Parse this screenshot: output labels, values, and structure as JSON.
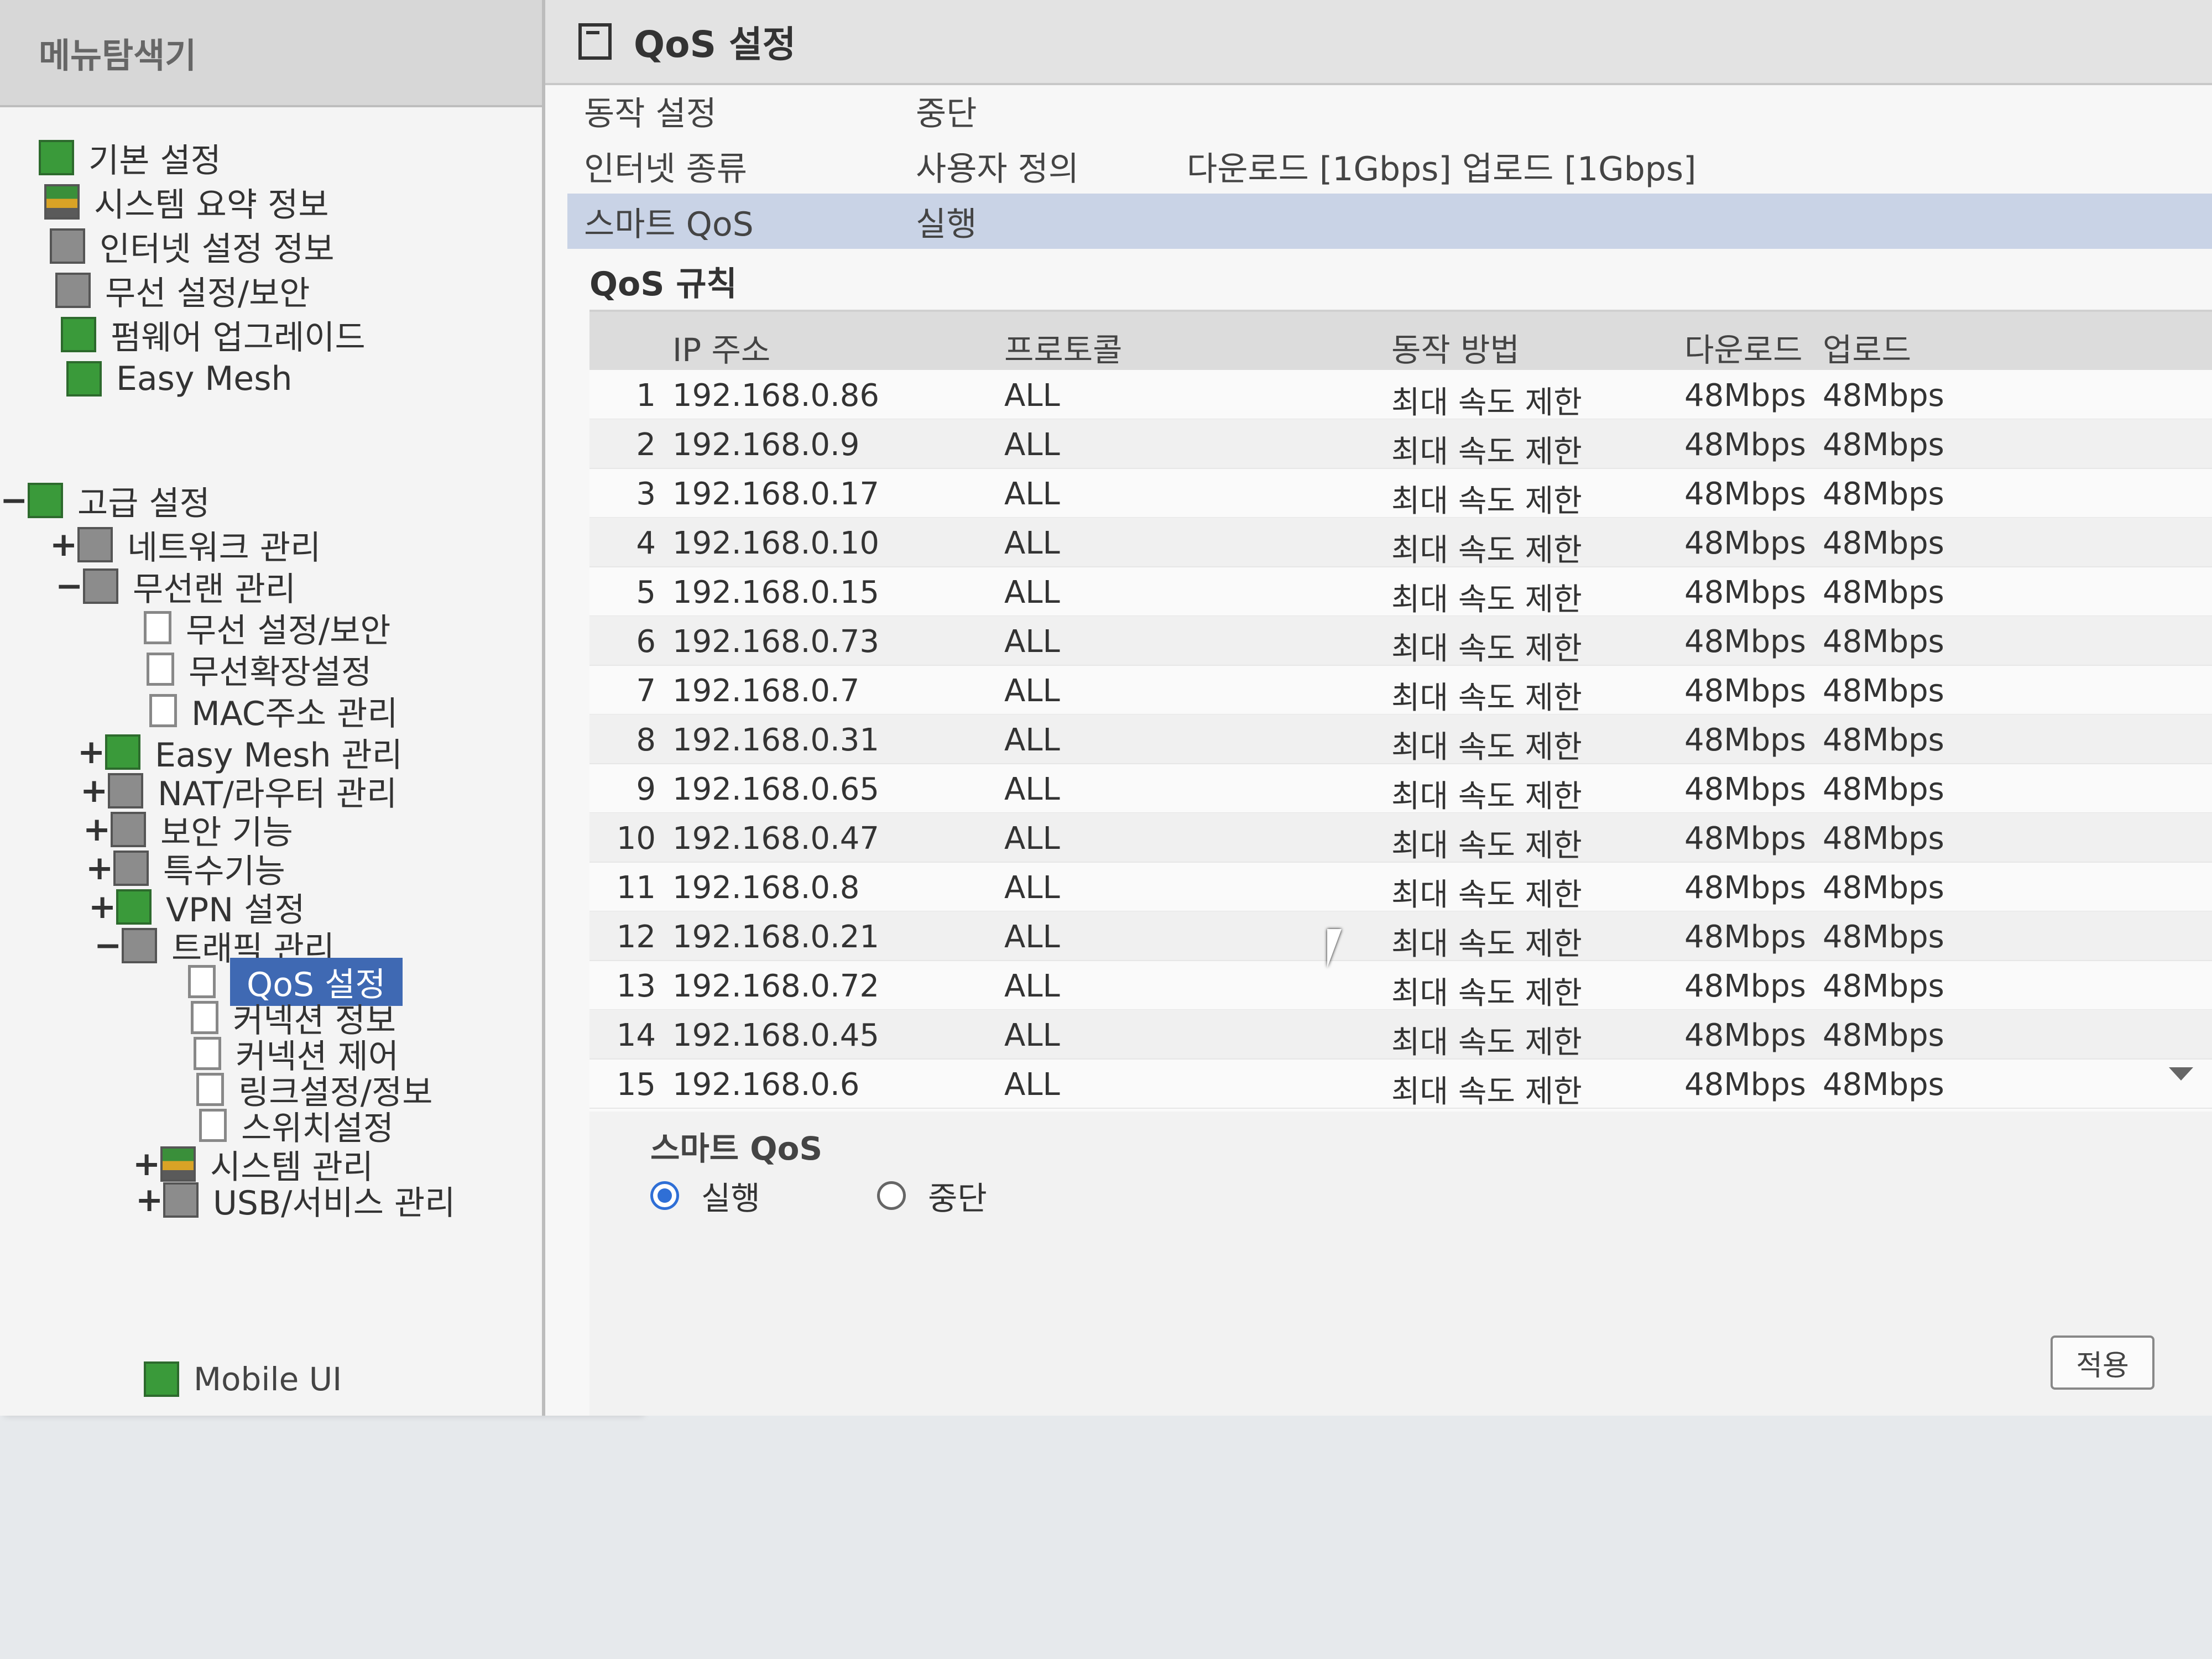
{
  "menu": {
    "header": "메뉴탐색기",
    "items": [
      {
        "label": "기본 설정",
        "expander": ""
      },
      {
        "label": "시스템 요약 정보",
        "expander": ""
      },
      {
        "label": "인터넷 설정 정보",
        "expander": ""
      },
      {
        "label": "무선 설정/보안",
        "expander": ""
      },
      {
        "label": "펌웨어 업그레이드",
        "expander": ""
      },
      {
        "label": "Easy Mesh",
        "expander": ""
      },
      {
        "label": "고급 설정",
        "expander": "−"
      },
      {
        "label": "네트워크 관리",
        "expander": "+"
      },
      {
        "label": "무선랜 관리",
        "expander": "−"
      },
      {
        "label": "무선 설정/보안",
        "expander": ""
      },
      {
        "label": "무선확장설정",
        "expander": ""
      },
      {
        "label": "MAC주소 관리",
        "expander": ""
      },
      {
        "label": "Easy Mesh 관리",
        "expander": "+"
      },
      {
        "label": "NAT/라우터 관리",
        "expander": "+"
      },
      {
        "label": "보안 기능",
        "expander": "+"
      },
      {
        "label": "특수기능",
        "expander": "+"
      },
      {
        "label": "VPN 설정",
        "expander": "+"
      },
      {
        "label": "트래픽 관리",
        "expander": "−"
      },
      {
        "label": "QoS 설정",
        "expander": ""
      },
      {
        "label": "커넥션 정보",
        "expander": ""
      },
      {
        "label": "커넥션 제어",
        "expander": ""
      },
      {
        "label": "링크설정/정보",
        "expander": ""
      },
      {
        "label": "스위치설정",
        "expander": ""
      },
      {
        "label": "시스템 관리",
        "expander": "+"
      },
      {
        "label": "USB/서비스 관리",
        "expander": "+"
      }
    ],
    "mobile_ui": "Mobile UI"
  },
  "page": {
    "title": "QoS 설정",
    "operation_label": "동작 설정",
    "operation_value": "중단",
    "internet_label": "인터넷 종류",
    "internet_value": "사용자 정의",
    "internet_speed": "다운로드 [1Gbps] 업로드 [1Gbps]",
    "smart_qos_label": "스마트 QoS",
    "smart_qos_value": "실행",
    "rules_title": "QoS 규칙"
  },
  "rules": {
    "headers": {
      "ip": "IP 주소",
      "protocol": "프로토콜",
      "action": "동작 방법",
      "download": "다운로드",
      "upload": "업로드"
    },
    "rows": [
      {
        "no": "1",
        "ip": "192.168.0.86",
        "protocol": "ALL",
        "action": "최대 속도 제한",
        "download": "48Mbps",
        "upload": "48Mbps"
      },
      {
        "no": "2",
        "ip": "192.168.0.9",
        "protocol": "ALL",
        "action": "최대 속도 제한",
        "download": "48Mbps",
        "upload": "48Mbps"
      },
      {
        "no": "3",
        "ip": "192.168.0.17",
        "protocol": "ALL",
        "action": "최대 속도 제한",
        "download": "48Mbps",
        "upload": "48Mbps"
      },
      {
        "no": "4",
        "ip": "192.168.0.10",
        "protocol": "ALL",
        "action": "최대 속도 제한",
        "download": "48Mbps",
        "upload": "48Mbps"
      },
      {
        "no": "5",
        "ip": "192.168.0.15",
        "protocol": "ALL",
        "action": "최대 속도 제한",
        "download": "48Mbps",
        "upload": "48Mbps"
      },
      {
        "no": "6",
        "ip": "192.168.0.73",
        "protocol": "ALL",
        "action": "최대 속도 제한",
        "download": "48Mbps",
        "upload": "48Mbps"
      },
      {
        "no": "7",
        "ip": "192.168.0.7",
        "protocol": "ALL",
        "action": "최대 속도 제한",
        "download": "48Mbps",
        "upload": "48Mbps"
      },
      {
        "no": "8",
        "ip": "192.168.0.31",
        "protocol": "ALL",
        "action": "최대 속도 제한",
        "download": "48Mbps",
        "upload": "48Mbps"
      },
      {
        "no": "9",
        "ip": "192.168.0.65",
        "protocol": "ALL",
        "action": "최대 속도 제한",
        "download": "48Mbps",
        "upload": "48Mbps"
      },
      {
        "no": "10",
        "ip": "192.168.0.47",
        "protocol": "ALL",
        "action": "최대 속도 제한",
        "download": "48Mbps",
        "upload": "48Mbps"
      },
      {
        "no": "11",
        "ip": "192.168.0.8",
        "protocol": "ALL",
        "action": "최대 속도 제한",
        "download": "48Mbps",
        "upload": "48Mbps"
      },
      {
        "no": "12",
        "ip": "192.168.0.21",
        "protocol": "ALL",
        "action": "최대 속도 제한",
        "download": "48Mbps",
        "upload": "48Mbps"
      },
      {
        "no": "13",
        "ip": "192.168.0.72",
        "protocol": "ALL",
        "action": "최대 속도 제한",
        "download": "48Mbps",
        "upload": "48Mbps"
      },
      {
        "no": "14",
        "ip": "192.168.0.45",
        "protocol": "ALL",
        "action": "최대 속도 제한",
        "download": "48Mbps",
        "upload": "48Mbps"
      },
      {
        "no": "15",
        "ip": "192.168.0.6",
        "protocol": "ALL",
        "action": "최대 속도 제한",
        "download": "48Mbps",
        "upload": "48Mbps"
      }
    ]
  },
  "smart_qos": {
    "title": "스마트 QoS",
    "options": [
      {
        "label": "실행",
        "checked": true
      },
      {
        "label": "중단",
        "checked": false
      }
    ],
    "apply_label": "적용"
  },
  "colors": {
    "selection": "#3f69b3",
    "highlight_row": "#c9d3e6",
    "radio_accent": "#2f6fd6"
  }
}
